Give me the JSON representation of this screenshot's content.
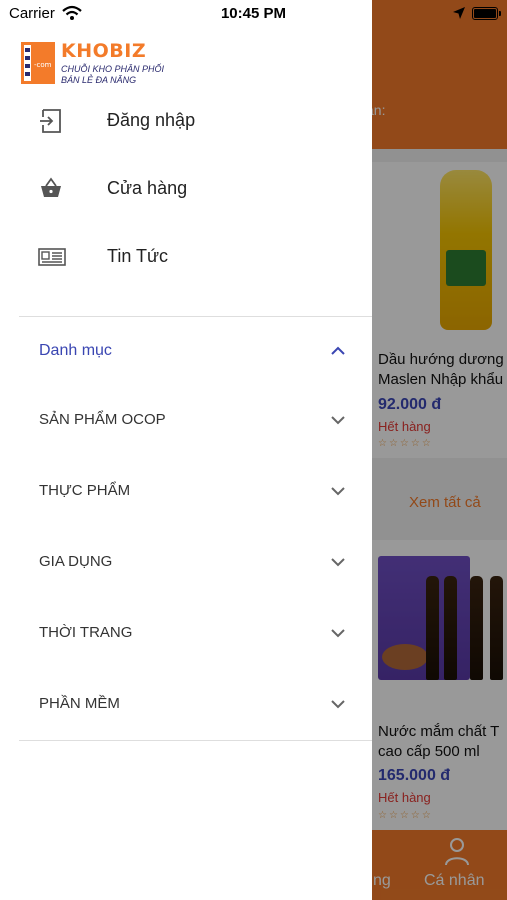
{
  "status_bar": {
    "carrier": "Carrier",
    "time": "10:45 PM"
  },
  "brand": {
    "name": "KHOBIZ",
    "tagline_1": "CHUỖI KHO PHÂN PHỐI",
    "tagline_2": "BÁN LẺ ĐA NĂNG",
    "logo_mark": "-com",
    "color": "#f37b2a"
  },
  "drawer": {
    "menu": [
      {
        "label": "Đăng nhập",
        "icon": "login-icon"
      },
      {
        "label": "Cửa hàng",
        "icon": "basket-icon"
      },
      {
        "label": "Tin Tức",
        "icon": "newspaper-icon"
      }
    ],
    "category_header": {
      "label": "Danh mục",
      "expanded": true
    },
    "categories": [
      {
        "label": "SẢN PHẨM OCOP"
      },
      {
        "label": "THỰC PHẨM"
      },
      {
        "label": "GIA DỤNG"
      },
      {
        "label": "THỜI TRANG"
      },
      {
        "label": "PHẦN MỀM"
      }
    ]
  },
  "background": {
    "banner_text": "ạn:",
    "products": [
      {
        "name_line_1": "Dầu hướng dương",
        "name_line_2": "Maslen Nhập khẩu",
        "price": "92.000 đ",
        "status": "Hết hàng",
        "stars": "☆☆☆☆☆"
      },
      {
        "name_line_1": "Nước mắm chất T",
        "name_line_2": "cao cấp 500 ml",
        "price": "165.000 đ",
        "status": "Hết hàng",
        "stars": "☆☆☆☆☆"
      }
    ],
    "see_all": "Xem tất cả",
    "tabs": [
      {
        "label": "ng"
      },
      {
        "label": "Cá nhân"
      }
    ]
  },
  "colors": {
    "accent": "#f37b2a",
    "price": "#3b46b8",
    "status": "#e53935",
    "category_header": "#3a46b2"
  }
}
